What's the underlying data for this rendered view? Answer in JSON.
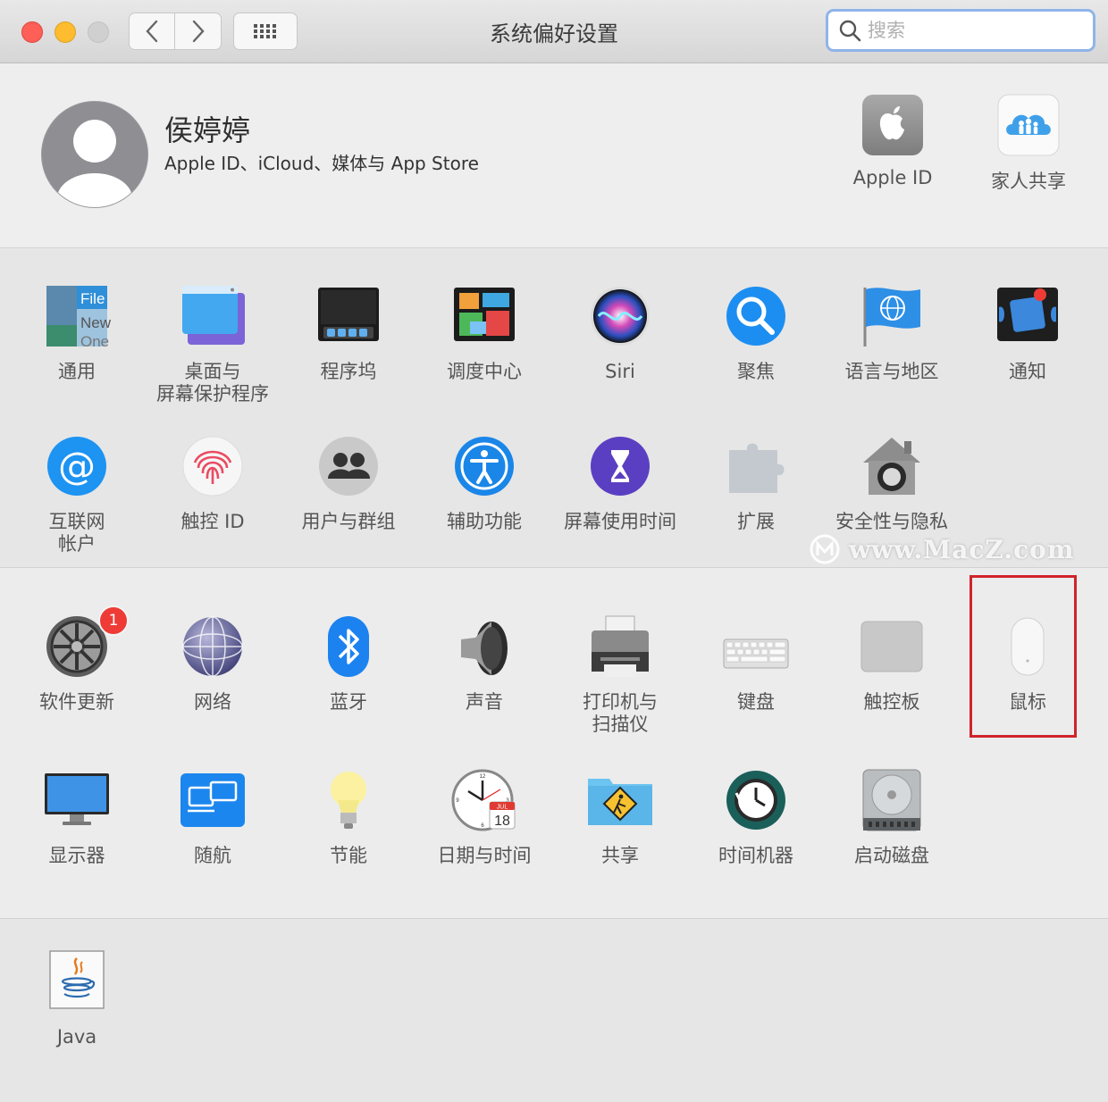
{
  "window": {
    "title": "系统偏好设置"
  },
  "search": {
    "placeholder": "搜索"
  },
  "account": {
    "name": "侯婷婷",
    "subtitle": "Apple ID、iCloud、媒体与 App Store",
    "tiles": [
      {
        "label": "Apple ID",
        "icon": "apple-id-icon"
      },
      {
        "label": "家人共享",
        "icon": "family-sharing-icon"
      }
    ]
  },
  "section1": {
    "row1": [
      {
        "label": "通用",
        "icon": "general-icon"
      },
      {
        "label": "桌面与\n屏幕保护程序",
        "icon": "desktop-screensaver-icon"
      },
      {
        "label": "程序坞",
        "icon": "dock-icon"
      },
      {
        "label": "调度中心",
        "icon": "mission-control-icon"
      },
      {
        "label": "Siri",
        "icon": "siri-icon"
      },
      {
        "label": "聚焦",
        "icon": "spotlight-icon"
      },
      {
        "label": "语言与地区",
        "icon": "language-region-icon"
      },
      {
        "label": "通知",
        "icon": "notifications-icon"
      }
    ],
    "row2": [
      {
        "label": "互联网\n帐户",
        "icon": "internet-accounts-icon"
      },
      {
        "label": "触控 ID",
        "icon": "touch-id-icon"
      },
      {
        "label": "用户与群组",
        "icon": "users-groups-icon"
      },
      {
        "label": "辅助功能",
        "icon": "accessibility-icon"
      },
      {
        "label": "屏幕使用时间",
        "icon": "screen-time-icon"
      },
      {
        "label": "扩展",
        "icon": "extensions-icon"
      },
      {
        "label": "安全性与隐私",
        "icon": "security-privacy-icon"
      }
    ]
  },
  "section2": {
    "row1": [
      {
        "label": "软件更新",
        "icon": "software-update-icon",
        "badge": "1"
      },
      {
        "label": "网络",
        "icon": "network-icon"
      },
      {
        "label": "蓝牙",
        "icon": "bluetooth-icon"
      },
      {
        "label": "声音",
        "icon": "sound-icon"
      },
      {
        "label": "打印机与\n扫描仪",
        "icon": "printers-scanners-icon"
      },
      {
        "label": "键盘",
        "icon": "keyboard-icon"
      },
      {
        "label": "触控板",
        "icon": "trackpad-icon"
      },
      {
        "label": "鼠标",
        "icon": "mouse-icon"
      }
    ],
    "row2": [
      {
        "label": "显示器",
        "icon": "displays-icon"
      },
      {
        "label": "随航",
        "icon": "sidecar-icon"
      },
      {
        "label": "节能",
        "icon": "energy-saver-icon"
      },
      {
        "label": "日期与时间",
        "icon": "date-time-icon",
        "calendar_month": "JUL",
        "calendar_day": "18"
      },
      {
        "label": "共享",
        "icon": "sharing-icon"
      },
      {
        "label": "时间机器",
        "icon": "time-machine-icon"
      },
      {
        "label": "启动磁盘",
        "icon": "startup-disk-icon"
      }
    ]
  },
  "section3": {
    "row1": [
      {
        "label": "Java",
        "icon": "java-icon"
      }
    ]
  },
  "watermark": {
    "text": "www.MacZ.com"
  },
  "colors": {
    "highlight": "#d0232b",
    "badge": "#ee3b36",
    "accent": "#1a82fb"
  }
}
